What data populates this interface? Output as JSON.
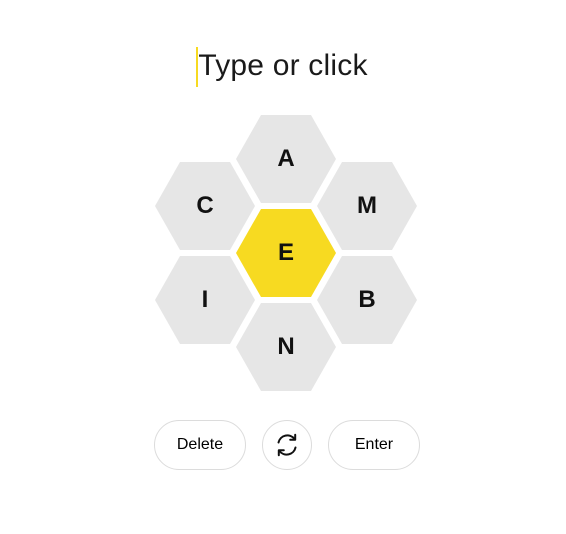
{
  "input": {
    "placeholder": "Type or click",
    "caret_color": "#f7da21"
  },
  "hive": {
    "center_color": "#f7da21",
    "outer_color": "#e6e6e6",
    "letters": {
      "top": "A",
      "upper_left": "C",
      "upper_right": "M",
      "center": "E",
      "lower_left": "I",
      "lower_right": "B",
      "bottom": "N"
    }
  },
  "controls": {
    "delete_label": "Delete",
    "shuffle_icon": "shuffle-icon",
    "enter_label": "Enter"
  }
}
